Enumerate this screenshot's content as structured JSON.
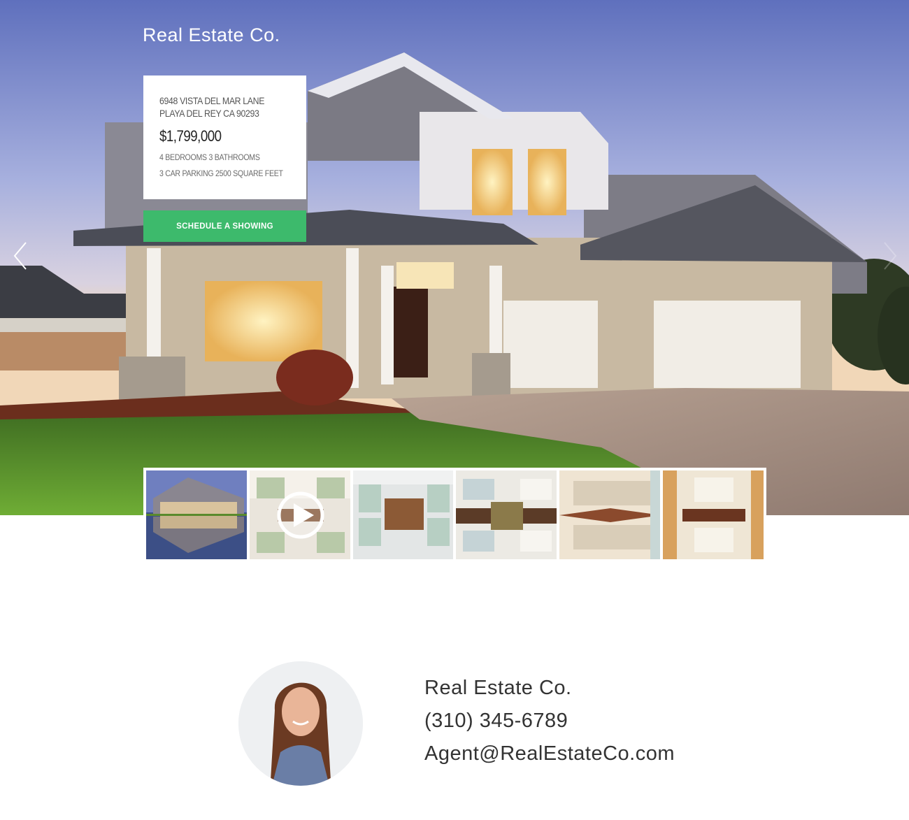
{
  "brand": "Real Estate Co.",
  "listing": {
    "address_line1": "6948 VISTA DEL MAR LANE",
    "address_line2": "PLAYA DEL REY CA 90293",
    "price": "$1,799,000",
    "details_line1": "4 BEDROOMS 3 BATHROOMS",
    "details_line2": "3 CAR PARKING 2500 SQUARE FEET"
  },
  "cta_label": "SCHEDULE A SHOWING",
  "accent_color": "#3dba6c",
  "gallery": {
    "thumbnails": [
      {
        "subject": "house-exterior"
      },
      {
        "subject": "dining-room-video"
      },
      {
        "subject": "kitchen"
      },
      {
        "subject": "living-room"
      },
      {
        "subject": "bedroom"
      },
      {
        "subject": "dining-table"
      }
    ]
  },
  "agent": {
    "company": "Real Estate Co.",
    "phone": "(310) 345-6789",
    "email": "Agent@RealEstateCo.com"
  }
}
